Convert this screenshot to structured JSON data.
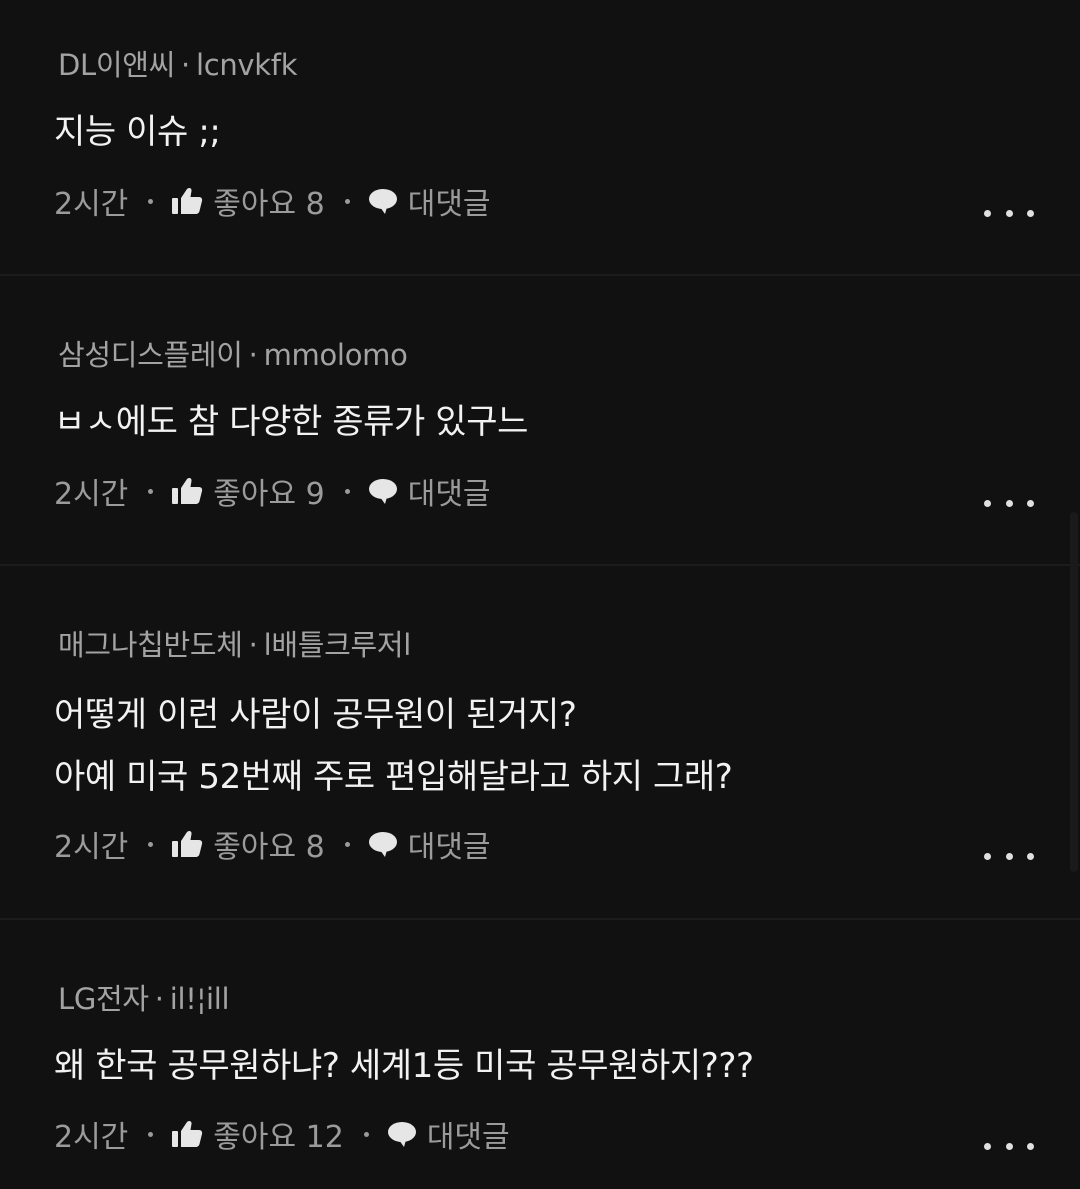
{
  "comments": [
    {
      "company": "DL이앤씨",
      "username": "lcnvkfk",
      "body": [
        "지능 이슈 ;;"
      ],
      "time": "2시간",
      "like_label": "좋아요 8",
      "reply_label": "대댓글"
    },
    {
      "company": "삼성디스플레이",
      "username": "mmolomo",
      "body": [
        "ㅂㅅ에도 참 다양한 종류가 있구느"
      ],
      "time": "2시간",
      "like_label": "좋아요 9",
      "reply_label": "대댓글"
    },
    {
      "company": "매그나칩반도체",
      "username": "l배틀크루저l",
      "body": [
        "어떻게 이런 사람이 공무원이 된거지?",
        "아예 미국 52번째 주로 편입해달라고 하지 그래?"
      ],
      "time": "2시간",
      "like_label": "좋아요 8",
      "reply_label": "대댓글"
    },
    {
      "company": "LG전자",
      "username": "il!¦ill",
      "body": [
        "왜 한국 공무원하냐? 세계1등 미국 공무원하지???"
      ],
      "time": "2시간",
      "like_label": "좋아요 12",
      "reply_label": "대댓글"
    }
  ],
  "separator": "·",
  "icons": {
    "like": "thumbs-up-icon",
    "reply": "speech-bubble-icon",
    "more": "more-dots-icon"
  },
  "colors": {
    "background": "#111111",
    "author_text": "#a3a3a3",
    "body_text": "#f2f2f2",
    "meta_text": "#9b9b9b",
    "divider": "#1c1c1c"
  }
}
